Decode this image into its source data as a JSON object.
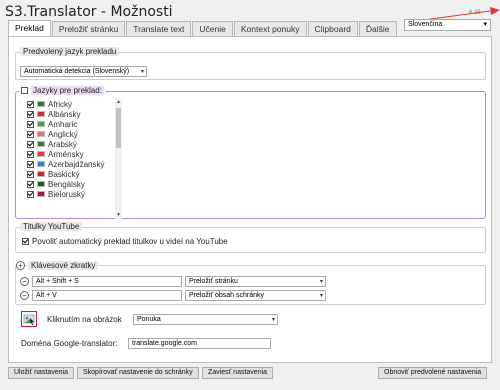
{
  "window": {
    "title": "S3.Translator - Možnosti",
    "version": "6.25"
  },
  "ui_language": {
    "value": "Slovenčina"
  },
  "tabs": [
    {
      "label": "Preklad",
      "active": true
    },
    {
      "label": "Preložiť stránku"
    },
    {
      "label": "Translate text"
    },
    {
      "label": "Učenie"
    },
    {
      "label": "Kontext ponuky"
    },
    {
      "label": "Clipboard"
    },
    {
      "label": "Ďalšie"
    }
  ],
  "default_lang": {
    "legend": "Predvolený jazyk prekladu",
    "value": "Automatická detekcia (Slovenský)"
  },
  "languages": {
    "legend": "Jazyky pre preklad:",
    "items": [
      {
        "label": "Africký",
        "color": "#2e7d32"
      },
      {
        "label": "Albánsky",
        "color": "#d32f2f"
      },
      {
        "label": "Amharic",
        "color": "#43a047"
      },
      {
        "label": "Anglický",
        "color": "#e57373"
      },
      {
        "label": "Arabský",
        "color": "#2e7d32"
      },
      {
        "label": "Arménsky",
        "color": "#e53935"
      },
      {
        "label": "Azerbajdžanský",
        "color": "#1e88e5"
      },
      {
        "label": "Baskický",
        "color": "#c62828"
      },
      {
        "label": "Bengálsky",
        "color": "#1b5e20"
      },
      {
        "label": "Bieloruský",
        "color": "#ad1457"
      }
    ]
  },
  "youtube": {
    "legend": "Titulky YouTube",
    "checkbox_label": "Povoliť automatický preklad titulkov u videí na YouTube"
  },
  "shortcuts": {
    "legend": "Klávesové zkratky",
    "rows": [
      {
        "keys": "Alt + Shift + S",
        "action": "Preložiť stránku"
      },
      {
        "keys": "Alt + V",
        "action": "Preložiť obsah schránky"
      }
    ]
  },
  "click_image": {
    "label": "Kliknutím na obrázok",
    "value": "Ponuka"
  },
  "domain": {
    "label": "Doména Google-translator:",
    "value": "translate.google.com"
  },
  "buttons": {
    "save": "Uložiť nastavenia",
    "copy": "Skopírovať nastavenie do schránky",
    "import": "Zaviesť nastavenia",
    "restore": "Obnoviť predvolené nastavenia"
  },
  "colors": {
    "accent_purple": "#b58bd6",
    "arrow_red": "#e53935"
  },
  "icons": {
    "expand": "plus-circle-icon",
    "remove": "minus-circle-icon",
    "image": "image-click-icon"
  }
}
